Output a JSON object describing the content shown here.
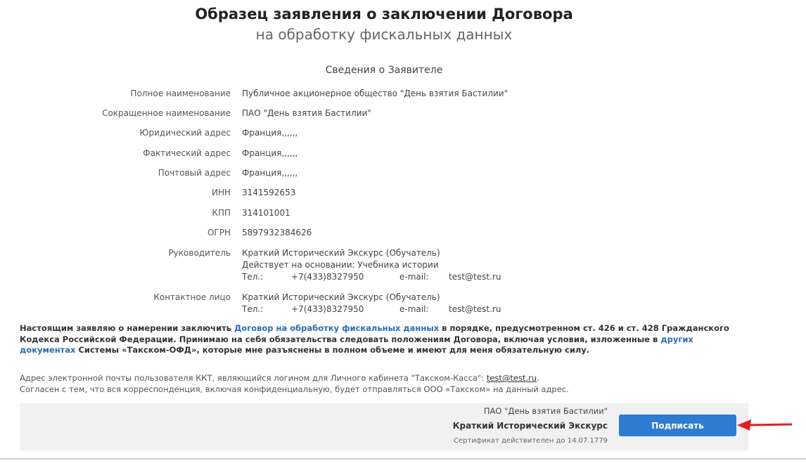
{
  "header": {
    "title": "Образец заявления о заключении Договора",
    "subtitle": "на обработку фискальных данных"
  },
  "applicant": {
    "heading": "Сведения о Заявителе",
    "fields": [
      {
        "label": "Полное наименование",
        "value": "Публичное акционерное общество \"День взятия Бастилии\""
      },
      {
        "label": "Сокращенное наименование",
        "value": "ПАО \"День взятия Бастилии\""
      },
      {
        "label": "Юридический адрес",
        "value": "Франция,,,,,,"
      },
      {
        "label": "Фактический адрес",
        "value": "Франция,,,,,,"
      },
      {
        "label": "Почтовый адрес",
        "value": "Франция,,,,,,"
      },
      {
        "label": "ИНН",
        "value": "3141592653"
      },
      {
        "label": "КПП",
        "value": "314101001"
      },
      {
        "label": "ОГРН",
        "value": "5897932384626"
      }
    ],
    "director": {
      "label": "Руководитель",
      "name": "Краткий Исторический Экскурс (Обучатель)",
      "basis": "Действует на основании: Учебника истории",
      "phone_label": "Тел.:",
      "phone": "+7(433)8327950",
      "email_label": "e-mail:",
      "email": "test@test.ru"
    },
    "contact": {
      "label": "Контактное лицо",
      "name": "Краткий Исторический Экскурс (Обучатель)",
      "phone_label": "Тел.:",
      "phone": "+7(433)8327950",
      "email_label": "e-mail:",
      "email": "test@test.ru"
    }
  },
  "statement": {
    "part1": "Настоящим заявляю о намерении заключить ",
    "link1": "Договор на обработку фискальных данных",
    "part2": " в порядке, предусмотренном ст. 426 и ст. 428 Гражданского Кодекса Российской Федерации. Принимаю на себя обязательства следовать положениям Договора, включая условия, изложенные в ",
    "link2": "других документах",
    "part3": " Системы «Такском-ОФД», которые мне разъяснены в полном объеме и имеют для меня обязательную силу."
  },
  "email_note": {
    "line1_prefix": "Адрес электронной почты пользователя ККТ, являющийся логином для Личного кабинета \"Такском-Касса\": ",
    "email": "test@test.ru",
    "line1_suffix": ".",
    "line2": "Согласен с тем, что вся корреспонденция, включая конфиденциальную, будет отправляться ООО «Такском» на данный адрес."
  },
  "sign_panel": {
    "org": "ПАО \"День взятия Бастилии\"",
    "signer": "Краткий Исторический Экскурс",
    "cert": "Сертификат действителен до 14.07.1779",
    "button_label": "Подписать"
  },
  "colors": {
    "button": "#2e7cd1",
    "link": "#2a6db5",
    "arrow": "#e02020",
    "panel": "#f1f1f1"
  },
  "icons": {
    "pointer": "red-arrow-icon"
  }
}
